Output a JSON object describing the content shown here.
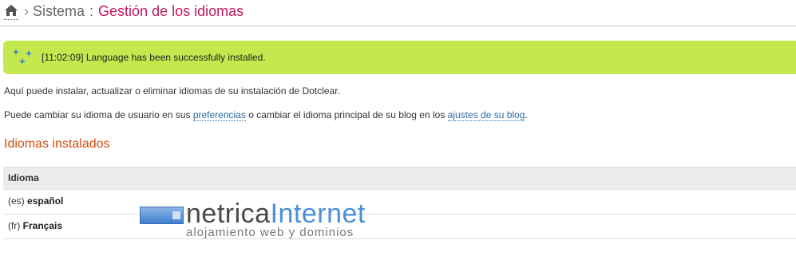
{
  "breadcrumb": {
    "home_icon": "home-icon",
    "separator": "›",
    "parent": "Sistema",
    "colon": ":",
    "current": "Gestión de los idiomas"
  },
  "notice": {
    "icon": "sparkles-icon",
    "time": "[11:02:09]",
    "message": "Language has been successfully installed.",
    "color": "#c3e94f"
  },
  "intro": {
    "line1": "Aquí puede instalar, actualizar o eliminar idiomas de su instalación de Dotclear.",
    "line2_part1": "Puede cambiar su idioma de usuario en sus ",
    "link_preferences": "preferencias",
    "line2_part2": " o cambiar el idioma principal de su blog en los ",
    "link_blog_settings": "ajustes de su blog",
    "line2_part3": "."
  },
  "installed": {
    "title": "Idiomas instalados",
    "column_header": "Idioma",
    "rows": [
      {
        "code": "(es)",
        "name": "español"
      },
      {
        "code": "(fr)",
        "name": "Français"
      }
    ]
  },
  "watermark": {
    "brand_part1": "netrica",
    "brand_part2": "Internet",
    "tagline": "alojamiento web y dominios"
  },
  "colors": {
    "accent_title": "#c2185b",
    "section_title": "#d24e0e",
    "link": "#2c6aa0"
  }
}
